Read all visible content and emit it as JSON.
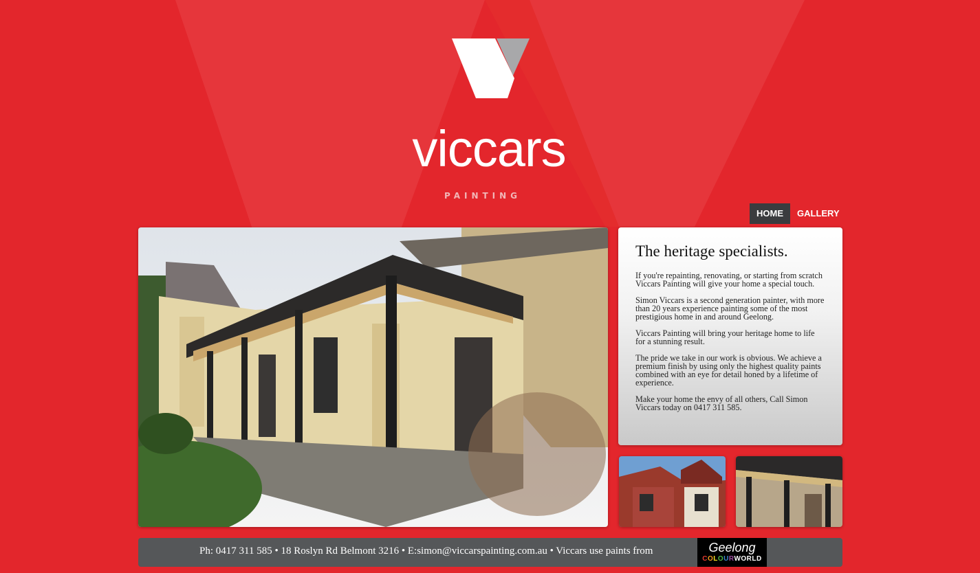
{
  "brand": {
    "name": "viccars",
    "tagline": "PAINTING",
    "colors": {
      "background": "#e3262c",
      "nav_active": "#3a3c3f",
      "footer": "#555759"
    }
  },
  "nav": {
    "items": [
      {
        "label": "HOME",
        "active": true
      },
      {
        "label": "GALLERY",
        "active": false
      }
    ]
  },
  "content": {
    "heading": "The heritage specialists.",
    "paragraphs": [
      "If you're repainting, renovating, or starting from scratch Viccars Painting will give your home a special touch.",
      "Simon Viccars is a second generation painter, with more than 20 years experience painting some of the most prestigious home in and around Geelong.",
      "Viccars Painting will bring your heritage home to life for a stunning result.",
      "The pride we take in our work is obvious. We achieve a premium finish by using only the highest quality paints combined with an eye for detail honed by a lifetime of experience.",
      "Make your home the envy of all others, Call Simon Viccars today on 0417 311 585."
    ]
  },
  "footer": {
    "text": "Ph: 0417 311 585 • 18 Roslyn Rd Belmont 3216 • E:simon@viccarspainting.com.au • Viccars use paints from",
    "partner_logo": {
      "line1": "Geelong",
      "line2": "COLOURWORLD"
    }
  }
}
